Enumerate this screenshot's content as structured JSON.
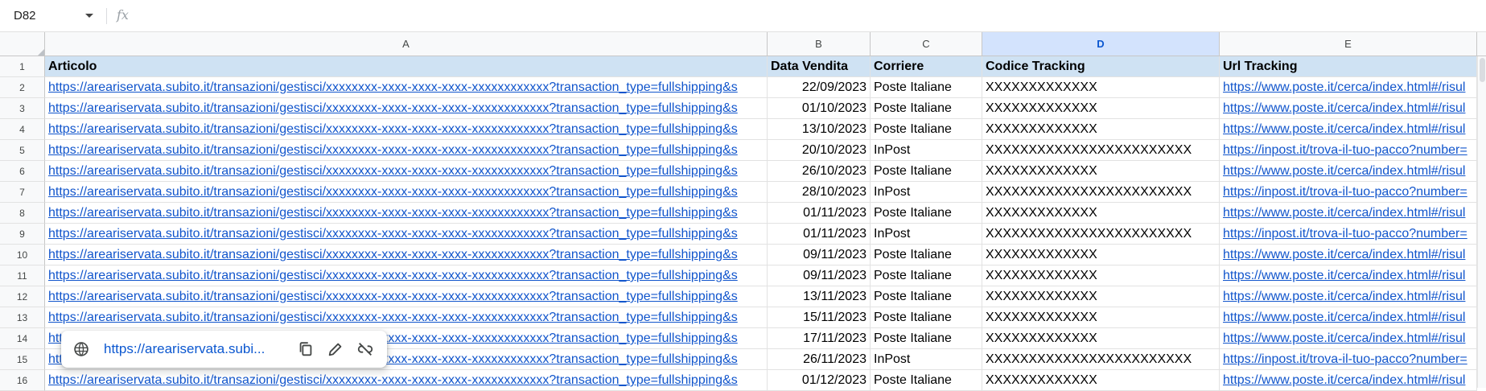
{
  "name_box": {
    "value": "D82"
  },
  "formula_bar": {
    "fx_label": "fx",
    "content": ""
  },
  "columns": [
    "A",
    "B",
    "C",
    "D",
    "E"
  ],
  "selected_column": "D",
  "headers": {
    "articolo": "Articolo",
    "data_vendita": "Data Vendita",
    "corriere": "Corriere",
    "codice_tracking": "Codice Tracking",
    "url_tracking": "Url Tracking"
  },
  "rows": [
    {
      "num": "1"
    },
    {
      "num": "2",
      "articolo": "https://areariservata.subito.it/transazioni/gestisci/xxxxxxxx-xxxx-xxxx-xxxx-xxxxxxxxxxxx?transaction_type=fullshipping&s",
      "data": "22/09/2023",
      "corriere": "Poste Italiane",
      "codice": "XXXXXXXXXXXXX",
      "url": "https://www.poste.it/cerca/index.html#/risul"
    },
    {
      "num": "3",
      "articolo": "https://areariservata.subito.it/transazioni/gestisci/xxxxxxxx-xxxx-xxxx-xxxx-xxxxxxxxxxxx?transaction_type=fullshipping&s",
      "data": "01/10/2023",
      "corriere": "Poste Italiane",
      "codice": "XXXXXXXXXXXXX",
      "url": "https://www.poste.it/cerca/index.html#/risul"
    },
    {
      "num": "4",
      "articolo": "https://areariservata.subito.it/transazioni/gestisci/xxxxxxxx-xxxx-xxxx-xxxx-xxxxxxxxxxxx?transaction_type=fullshipping&s",
      "data": "13/10/2023",
      "corriere": "Poste Italiane",
      "codice": "XXXXXXXXXXXXX",
      "url": "https://www.poste.it/cerca/index.html#/risul"
    },
    {
      "num": "5",
      "articolo": "https://areariservata.subito.it/transazioni/gestisci/xxxxxxxx-xxxx-xxxx-xxxx-xxxxxxxxxxxx?transaction_type=fullshipping&s",
      "data": "20/10/2023",
      "corriere": "InPost",
      "codice": "XXXXXXXXXXXXXXXXXXXXXXXX",
      "url": "https://inpost.it/trova-il-tuo-pacco?number="
    },
    {
      "num": "6",
      "articolo": "https://areariservata.subito.it/transazioni/gestisci/xxxxxxxx-xxxx-xxxx-xxxx-xxxxxxxxxxxx?transaction_type=fullshipping&s",
      "data": "26/10/2023",
      "corriere": "Poste Italiane",
      "codice": "XXXXXXXXXXXXX",
      "url": "https://www.poste.it/cerca/index.html#/risul"
    },
    {
      "num": "7",
      "articolo": "https://areariservata.subito.it/transazioni/gestisci/xxxxxxxx-xxxx-xxxx-xxxx-xxxxxxxxxxxx?transaction_type=fullshipping&s",
      "data": "28/10/2023",
      "corriere": "InPost",
      "codice": "XXXXXXXXXXXXXXXXXXXXXXXX",
      "url": "https://inpost.it/trova-il-tuo-pacco?number="
    },
    {
      "num": "8",
      "articolo": "https://areariservata.subito.it/transazioni/gestisci/xxxxxxxx-xxxx-xxxx-xxxx-xxxxxxxxxxxx?transaction_type=fullshipping&s",
      "data": "01/11/2023",
      "corriere": "Poste Italiane",
      "codice": "XXXXXXXXXXXXX",
      "url": "https://www.poste.it/cerca/index.html#/risul"
    },
    {
      "num": "9",
      "articolo": "https://areariservata.subito.it/transazioni/gestisci/xxxxxxxx-xxxx-xxxx-xxxx-xxxxxxxxxxxx?transaction_type=fullshipping&s",
      "data": "01/11/2023",
      "corriere": "InPost",
      "codice": "XXXXXXXXXXXXXXXXXXXXXXXX",
      "url": "https://inpost.it/trova-il-tuo-pacco?number="
    },
    {
      "num": "10",
      "articolo": "https://areariservata.subito.it/transazioni/gestisci/xxxxxxxx-xxxx-xxxx-xxxx-xxxxxxxxxxxx?transaction_type=fullshipping&s",
      "data": "09/11/2023",
      "corriere": "Poste Italiane",
      "codice": "XXXXXXXXXXXXX",
      "url": "https://www.poste.it/cerca/index.html#/risul"
    },
    {
      "num": "11",
      "articolo": "https://areariservata.subito.it/transazioni/gestisci/xxxxxxxx-xxxx-xxxx-xxxx-xxxxxxxxxxxx?transaction_type=fullshipping&s",
      "data": "09/11/2023",
      "corriere": "Poste Italiane",
      "codice": "XXXXXXXXXXXXX",
      "url": "https://www.poste.it/cerca/index.html#/risul"
    },
    {
      "num": "12",
      "articolo": "https://areariservata.subito.it/transazioni/gestisci/xxxxxxxx-xxxx-xxxx-xxxx-xxxxxxxxxxxx?transaction_type=fullshipping&s",
      "data": "13/11/2023",
      "corriere": "Poste Italiane",
      "codice": "XXXXXXXXXXXXX",
      "url": "https://www.poste.it/cerca/index.html#/risul"
    },
    {
      "num": "13",
      "articolo": "https://areariservata.subito.it/transazioni/gestisci/xxxxxxxx-xxxx-xxxx-xxxx-xxxxxxxxxxxx?transaction_type=fullshipping&s",
      "data": "15/11/2023",
      "corriere": "Poste Italiane",
      "codice": "XXXXXXXXXXXXX",
      "url": "https://www.poste.it/cerca/index.html#/risul"
    },
    {
      "num": "14",
      "articolo": "https://areariservata.subito.it/transazioni/gestisci/xxxxxxxx-xxxx-xxxx-xxxx-xxxxxxxxxxxx?transaction_type=fullshipping&s",
      "data": "17/11/2023",
      "corriere": "Poste Italiane",
      "codice": "XXXXXXXXXXXXX",
      "url": "https://www.poste.it/cerca/index.html#/risul"
    },
    {
      "num": "15",
      "articolo": "https://areariservata.subito.it/transazioni/gestisci/xxxxxxxx-xxxx-xxxx-xxxx-xxxxxxxxxxxx?transaction_type=fullshipping&s",
      "data": "26/11/2023",
      "corriere": "InPost",
      "codice": "XXXXXXXXXXXXXXXXXXXXXXXX",
      "url": "https://inpost.it/trova-il-tuo-pacco?number="
    },
    {
      "num": "16",
      "articolo": "https://areariservata.subito.it/transazioni/gestisci/xxxxxxxx-xxxx-xxxx-xxxx-xxxxxxxxxxxx?transaction_type=fullshipping&s",
      "data": "01/12/2023",
      "corriere": "Poste Italiane",
      "codice": "XXXXXXXXXXXXX",
      "url": "https://www.poste.it/cerca/index.html#/risul"
    }
  ],
  "link_popup": {
    "url": "https://areariservata.subi...",
    "globe_icon": "globe-icon",
    "copy_icon": "copy-icon",
    "edit_icon": "edit-icon",
    "unlink_icon": "unlink-icon"
  },
  "colors": {
    "header_fill": "#cfe2f3",
    "link": "#1155cc",
    "selected_column_header": "#d3e3fd",
    "selected_column_text": "#0b57d0"
  }
}
